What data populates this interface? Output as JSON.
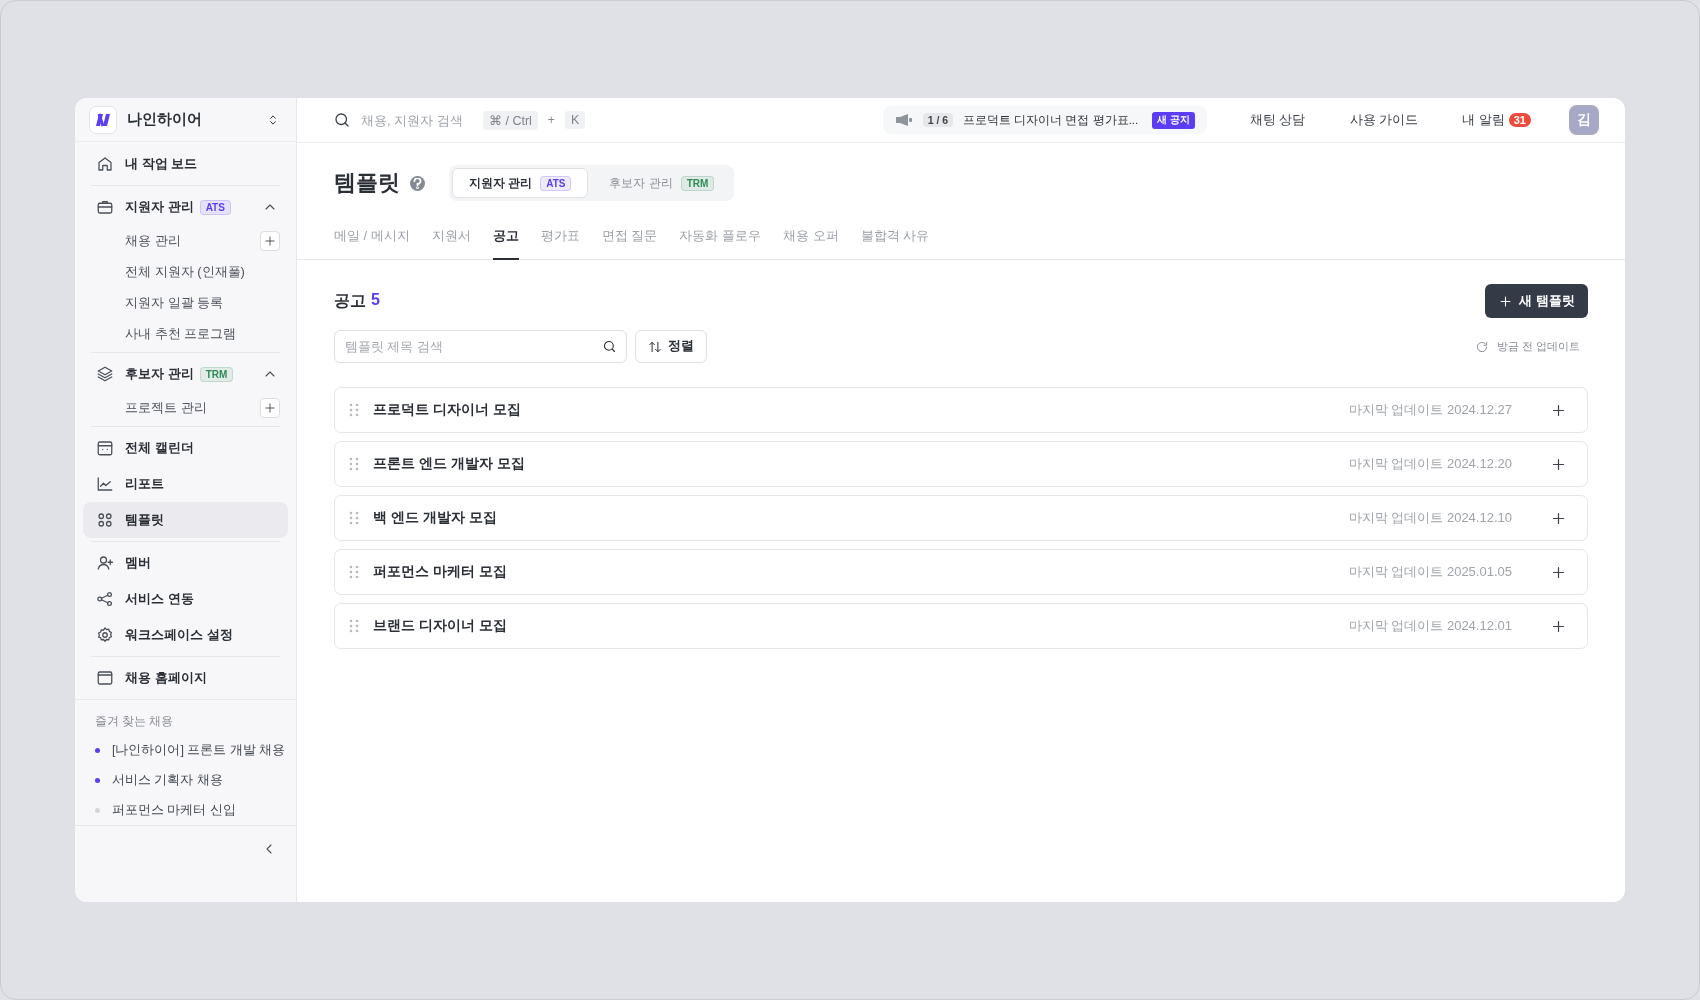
{
  "sidebar": {
    "workspace": {
      "name": "나인하이어"
    },
    "groups": [
      {
        "items": [
          {
            "label": "내 작업 보드",
            "selected": false
          }
        ]
      },
      {
        "items": [
          {
            "label": "지원자 관리",
            "badge": "ATS",
            "color": "#5b3df5",
            "expanded": true,
            "children": [
              {
                "label": "채용 관리",
                "kind": "add"
              },
              {
                "label": "전체 지원자 (인재풀)",
                "kind": "plain"
              },
              {
                "label": "지원자 일괄 등록",
                "kind": "plain"
              },
              {
                "label": "사내 추천 프로그램",
                "kind": "plain"
              }
            ]
          }
        ]
      },
      {
        "items": [
          {
            "label": "후보자 관리",
            "badge": "TRM",
            "color": "#2e8b57",
            "expanded": true,
            "children": [
              {
                "label": "프로젝트 관리",
                "kind": "add"
              }
            ]
          }
        ]
      },
      {
        "items": [
          {
            "label": "전체 캘린더",
            "selected": false
          },
          {
            "label": "리포트",
            "selected": false
          },
          {
            "label": "템플릿",
            "selected": true
          }
        ]
      },
      {
        "items": [
          {
            "label": "멤버",
            "selected": false
          },
          {
            "label": "서비스 연동",
            "selected": false
          },
          {
            "label": "워크스페이스 설정",
            "selected": false
          }
        ]
      },
      {
        "items": [
          {
            "label": "채용 홈페이지",
            "selected": false
          }
        ]
      }
    ],
    "favorites": {
      "title": "즐겨 찾는 채용",
      "items": [
        {
          "label": "[나인하이어] 프론트 개발 채용",
          "color": "#5b3df5"
        },
        {
          "label": "서비스 기획자 채용",
          "color": "#5b3df5"
        },
        {
          "label": "퍼포먼스 마케터 신입",
          "color": "#d4d6db"
        }
      ]
    }
  },
  "topbar": {
    "search": {
      "placeholder": "채용, 지원자 검색",
      "keys": [
        "⌘ / Ctrl",
        "K"
      ],
      "joiner": "+"
    },
    "notice": {
      "counter": "1 / 6",
      "text": "프로덕트 디자이너 면접 평가표...",
      "badge": "새 공지"
    },
    "links": [
      "채팅 상담",
      "사용 가이드"
    ],
    "alerts": {
      "label": "내 알림",
      "count": "31"
    },
    "avatar": {
      "initial": "김"
    }
  },
  "page": {
    "title": "템플릿",
    "segments": [
      {
        "label": "지원자 관리",
        "badge": "ATS",
        "color": "#5b3df5",
        "selected": true
      },
      {
        "label": "후보자 관리",
        "badge": "TRM",
        "color": "#2e8b57",
        "selected": false
      }
    ],
    "tabs": [
      {
        "label": "메일 / 메시지",
        "selected": false
      },
      {
        "label": "지원서",
        "selected": false
      },
      {
        "label": "공고",
        "selected": true
      },
      {
        "label": "평가표",
        "selected": false
      },
      {
        "label": "면접 질문",
        "selected": false
      },
      {
        "label": "자동화 플로우",
        "selected": false
      },
      {
        "label": "채용 오퍼",
        "selected": false
      },
      {
        "label": "불합격 사유",
        "selected": false
      }
    ],
    "section": {
      "title": "공고",
      "count": "5"
    },
    "new_button": "새 탬플릿",
    "search": {
      "placeholder": "템플릿 제목 검색"
    },
    "sort": "정렬",
    "refresh": "방금 전 업데이트",
    "rows": [
      {
        "title": "프로덕트 디자이너 모집",
        "updated": "마지막 업데이트 2024.12.27"
      },
      {
        "title": "프론트 엔드 개발자 모집",
        "updated": "마지막 업데이트 2024.12.20"
      },
      {
        "title": "백 엔드 개발자 모집",
        "updated": "마지막 업데이트 2024.12.10"
      },
      {
        "title": "퍼포먼스 마케터 모집",
        "updated": "마지막 업데이트 2025.01.05"
      },
      {
        "title": "브랜드 디자이너 모집",
        "updated": "마지막 업데이트 2024.12.01"
      }
    ]
  }
}
